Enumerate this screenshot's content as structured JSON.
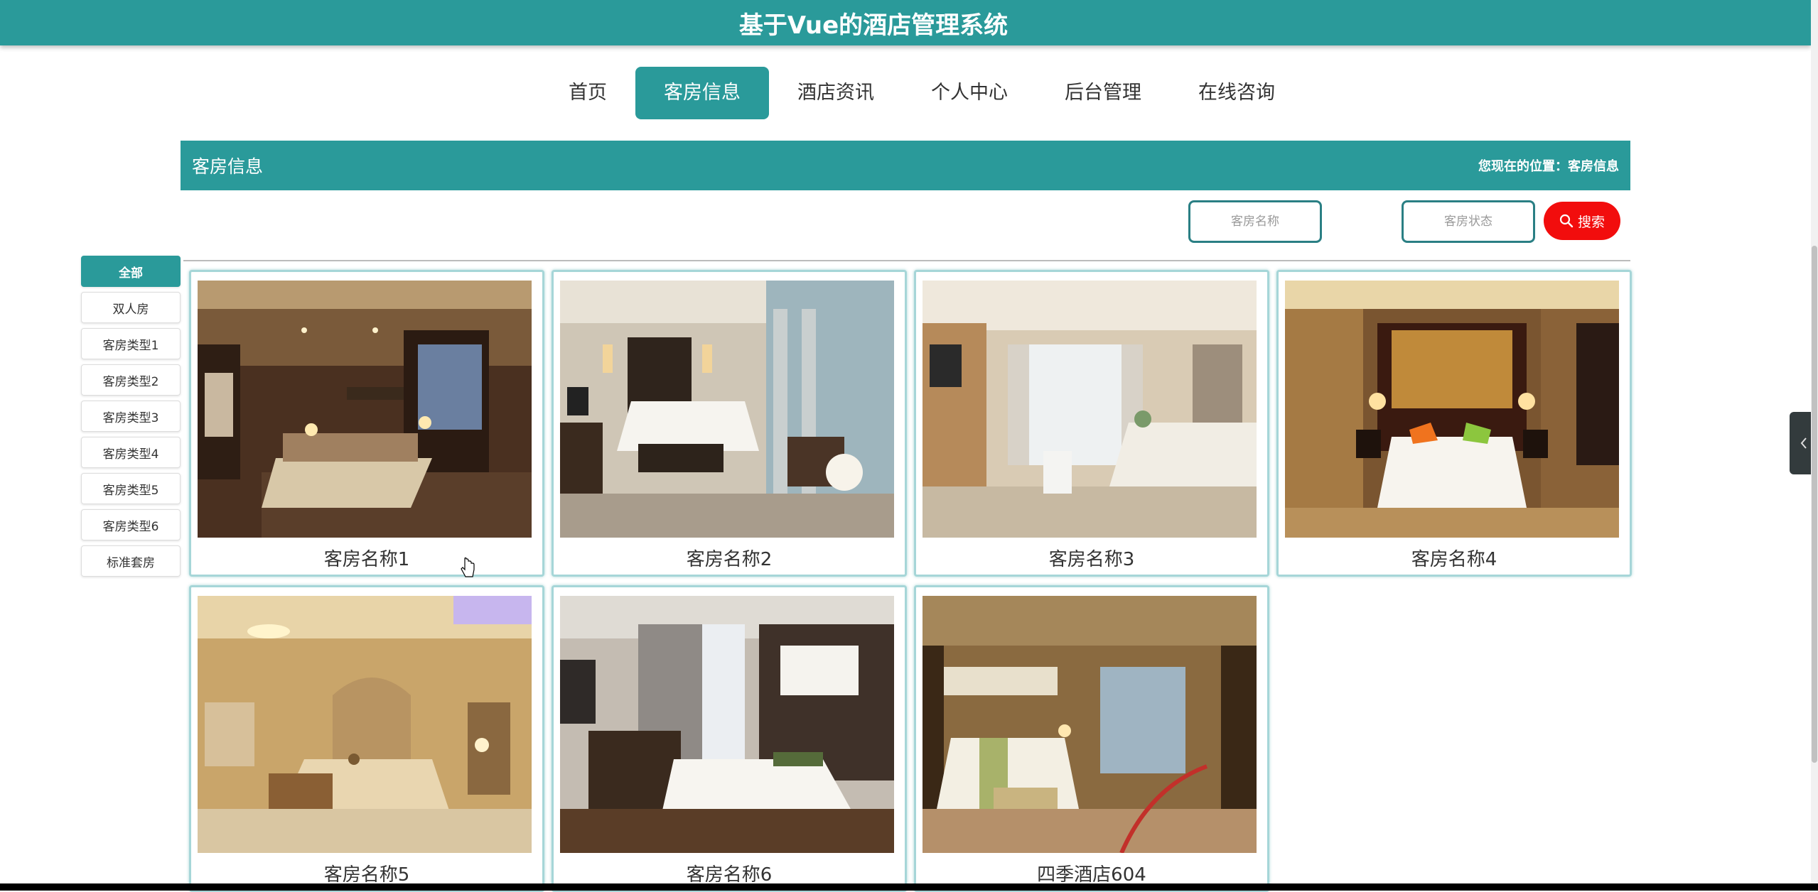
{
  "header": {
    "title": "基于Vue的酒店管理系统"
  },
  "nav": {
    "items": [
      {
        "label": "首页"
      },
      {
        "label": "客房信息",
        "active": true
      },
      {
        "label": "酒店资讯"
      },
      {
        "label": "个人中心"
      },
      {
        "label": "后台管理"
      },
      {
        "label": "在线咨询"
      }
    ]
  },
  "banner": {
    "title": "客房信息",
    "location": "您现在的位置：客房信息"
  },
  "search": {
    "name_placeholder": "客房名称",
    "status_placeholder": "客房状态",
    "button_label": "搜索"
  },
  "categories": [
    {
      "label": "全部",
      "active": true
    },
    {
      "label": "双人房"
    },
    {
      "label": "客房类型1"
    },
    {
      "label": "客房类型2"
    },
    {
      "label": "客房类型3"
    },
    {
      "label": "客房类型4"
    },
    {
      "label": "客房类型5"
    },
    {
      "label": "客房类型6"
    },
    {
      "label": "标准套房"
    }
  ],
  "rooms": [
    {
      "name": "客房名称1"
    },
    {
      "name": "客房名称2"
    },
    {
      "name": "客房名称3"
    },
    {
      "name": "客房名称4"
    },
    {
      "name": "客房名称5"
    },
    {
      "name": "客房名称6"
    },
    {
      "name": "四季酒店604"
    }
  ],
  "colors": {
    "primary": "#2a9a9a",
    "search_button": "#f20d0d"
  },
  "icons": {
    "search": "search-icon",
    "collapse": "chevron-left-icon"
  }
}
